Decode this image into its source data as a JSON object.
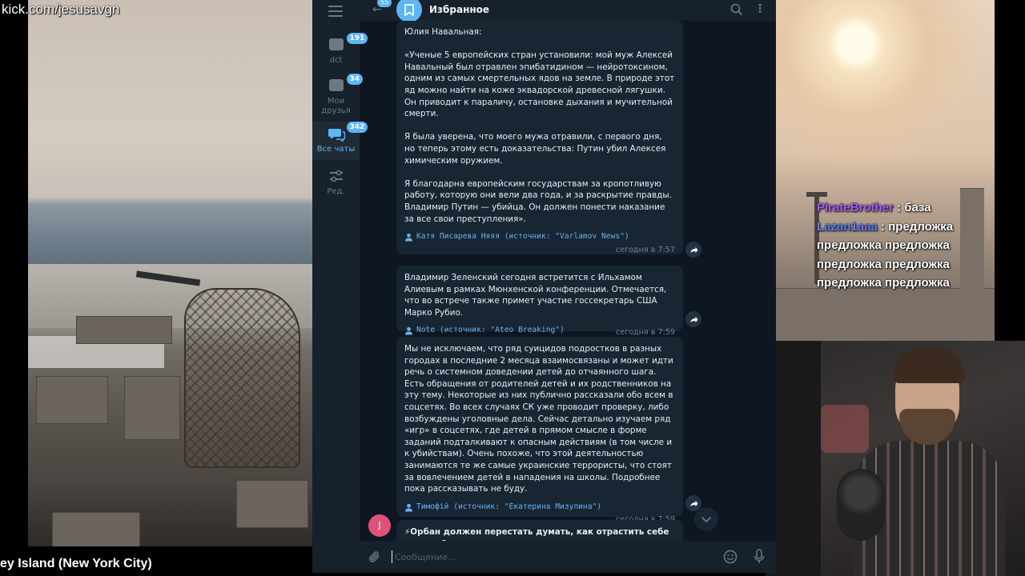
{
  "overlay": {
    "kick_url": "kick.com/jesusavgn",
    "location": "ey Island (New York City)"
  },
  "stream_chat": [
    {
      "user": "PirateBrother",
      "sep": " : ",
      "text": "база",
      "color": "#a55cf3"
    },
    {
      "user": "Lazan1aaa",
      "sep": " : ",
      "text": "предложка предложка предложка предложка предложка предложка предложка",
      "color": "#5c7ff3"
    }
  ],
  "telegram": {
    "header": {
      "title": "Избранное",
      "back_badge": "55"
    },
    "rail": {
      "items": [
        {
          "label": "dct",
          "badge": "191"
        },
        {
          "label": "Мои друзья",
          "badge": "34"
        },
        {
          "label": "Все чаты",
          "badge": "342"
        },
        {
          "label": "Ред."
        }
      ]
    },
    "messages": [
      {
        "text": "Юлия Навальная:\n\n«Ученые 5 европейских стран установили: мой муж Алексей Навальный был отравлен эпибатидином — нейротоксином, одним из самых смертельных ядов на земле. В природе этот яд можно найти на коже эквадорской древесной лягушки. Он приводит к параличу, остановке дыхания и мучительной смерти.\n\nЯ была уверена, что моего мужа отравили, с первого дня, но теперь этому есть доказательства: Путин убил Алексея химическим оружием.\n\nЯ благодарна европейским государствам за кропотливую работу, которую они вели два года, и за раскрытие правды. Владимир Путин — убийца. Он должен понести наказание за все свои преступления».",
        "source": "Катя Писарева Няяя (источник: \"Varlamov News\")",
        "time": "сегодня в 7:57"
      },
      {
        "text": "Владимир Зеленский сегодня встретится с Ильхамом Алиевым в рамках Мюнхенской конференции. Отмечается, что во встрече также примет участие госсекретарь США Марко Рубио.",
        "source": "Note (источник: \"Ateo Breaking\")",
        "time": "сегодня в 7:59"
      },
      {
        "text": "Мы не исключаем, что ряд суицидов подростков в разных городах в последние 2 месяца взаимосвязаны и может идти речь о системном доведении детей до отчаянного шага. Есть обращения от родителей детей и их родственников на эту тему. Некоторые из них публично рассказали обо всем в соцсетях. Во всех случаях СК уже проводит проверку, либо возбуждены уголовные дела. Сейчас детально изучаем ряд «игр» в соцсетях, где детей в прямом смысле в форме заданий подталкивают к опасным действиям (в том числе и к убийствам). Очень похоже, что этой деятельностью занимаются те же самые украинские террористы, что стоят за вовлечением детей в нападения на школы. Подробнее пока рассказывать не буду.",
        "source": "Тимофій (источник: \"Екатерина Мизулина\")",
        "time": "сегодня в 7:59"
      },
      {
        "text": "⚡Орбан должен перестать думать, как отрастить себе живот. Он должен думать, как наращивать армию —",
        "avatar_letter": "J"
      }
    ],
    "composer": {
      "placeholder": "Сообщение..."
    }
  }
}
